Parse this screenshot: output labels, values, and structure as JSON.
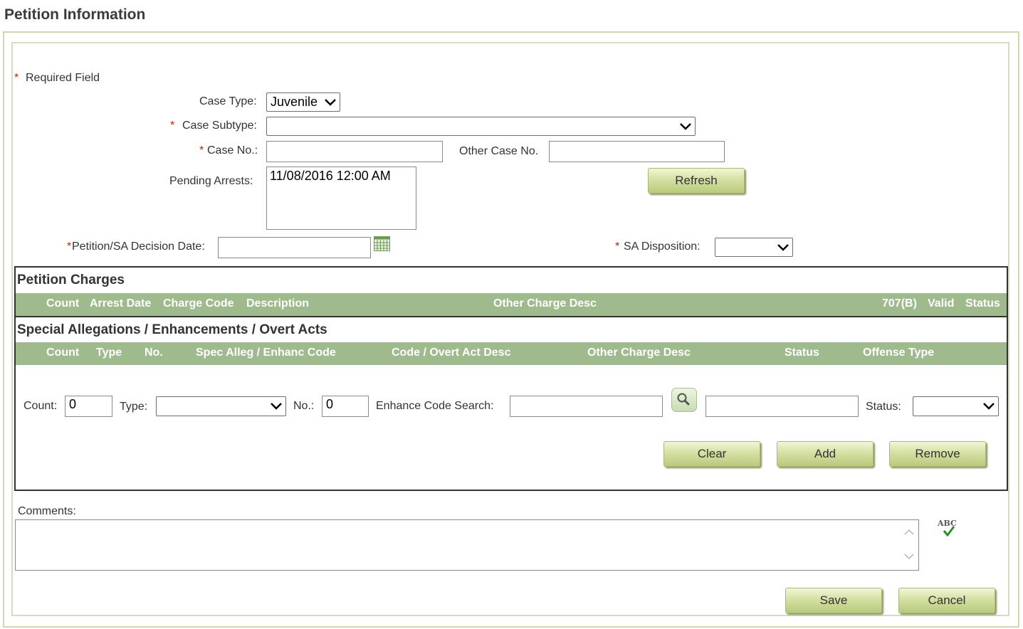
{
  "page": {
    "title": "Petition Information"
  },
  "form": {
    "required_marker": "*",
    "required_note": "Required Field",
    "case_type": {
      "label": "Case Type:",
      "value": "Juvenile"
    },
    "case_subtype": {
      "label": "Case Subtype:",
      "value": ""
    },
    "case_no": {
      "label": "Case No.:",
      "value": ""
    },
    "other_case_no": {
      "label": "Other Case No.",
      "value": ""
    },
    "pending_arrests": {
      "label": "Pending Arrests:",
      "items": [
        "11/08/2016 12:00 AM"
      ]
    },
    "refresh_label": "Refresh",
    "decision_date": {
      "label": "Petition/SA Decision Date:",
      "value": ""
    },
    "sa_disposition": {
      "label": "SA Disposition:",
      "value": ""
    }
  },
  "petition_charges": {
    "title": "Petition Charges",
    "columns": [
      "Count",
      "Arrest Date",
      "Charge Code",
      "Description",
      "Other Charge Desc",
      "707(B)",
      "Valid",
      "Status"
    ]
  },
  "special_allegations": {
    "title": "Special Allegations / Enhancements / Overt Acts",
    "columns": [
      "Count",
      "Type",
      "No.",
      "Spec Alleg / Enhanc Code",
      "Code / Overt Act Desc",
      "Other Charge Desc",
      "Status",
      "Offense Type"
    ],
    "count": {
      "label": "Count:",
      "value": "0"
    },
    "type": {
      "label": "Type:",
      "value": ""
    },
    "no": {
      "label": "No.:",
      "value": "0"
    },
    "enhance_search": {
      "label": "Enhance Code Search:",
      "value": ""
    },
    "enhance_desc_value": "",
    "status": {
      "label": "Status:",
      "value": ""
    },
    "clear_label": "Clear",
    "add_label": "Add",
    "remove_label": "Remove"
  },
  "comments": {
    "label": "Comments:",
    "value": "",
    "spellcheck_icon": "ABC"
  },
  "footer": {
    "save_label": "Save",
    "cancel_label": "Cancel"
  },
  "colors": {
    "header_bar": "#9fba8c",
    "button_top": "#f2f6d8",
    "button_bottom": "#b9ca7c",
    "border": "#cdd8b4",
    "required": "#cc2200"
  }
}
